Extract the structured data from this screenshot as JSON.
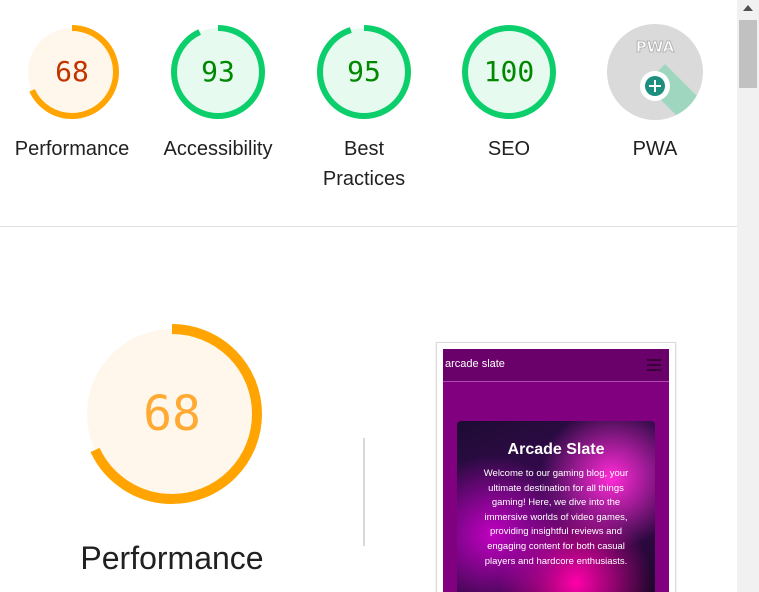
{
  "gauges": [
    {
      "score": "68",
      "label": "Performance",
      "value_fraction": 0.68,
      "color": "#ffa400",
      "text_color": "#c33300",
      "fill": "#fff7eb"
    },
    {
      "score": "93",
      "label": "Accessibility",
      "value_fraction": 0.93,
      "color": "#0cce6b",
      "text_color": "#008800",
      "fill": "#e6faf0"
    },
    {
      "score": "95",
      "label": "Best Practices",
      "value_fraction": 0.95,
      "color": "#0cce6b",
      "text_color": "#008800",
      "fill": "#e6faf0"
    },
    {
      "score": "100",
      "label": "SEO",
      "value_fraction": 1.0,
      "color": "#0cce6b",
      "text_color": "#008800",
      "fill": "#e6faf0"
    },
    {
      "score": "",
      "label": "PWA",
      "icon": "pwa-icon",
      "color": "#dadada"
    }
  ],
  "pwa": {
    "badge_text": "PWA",
    "badge_icon": "plus-icon",
    "badge_color": "#1e8e7e"
  },
  "performance": {
    "score": "68",
    "title": "Performance",
    "value_fraction": 0.68,
    "color": "#ffa400",
    "fill": "#fff7eb"
  },
  "screenshot": {
    "brand": "arcade slate",
    "menu_icon": "hamburger-icon",
    "hero_title": "Arcade Slate",
    "hero_text": "Welcome to our gaming blog, your ultimate destination for all things gaming! Here, we dive into the immersive worlds of video games, providing insightful reviews and engaging content for both casual players and hardcore enthusiasts."
  }
}
